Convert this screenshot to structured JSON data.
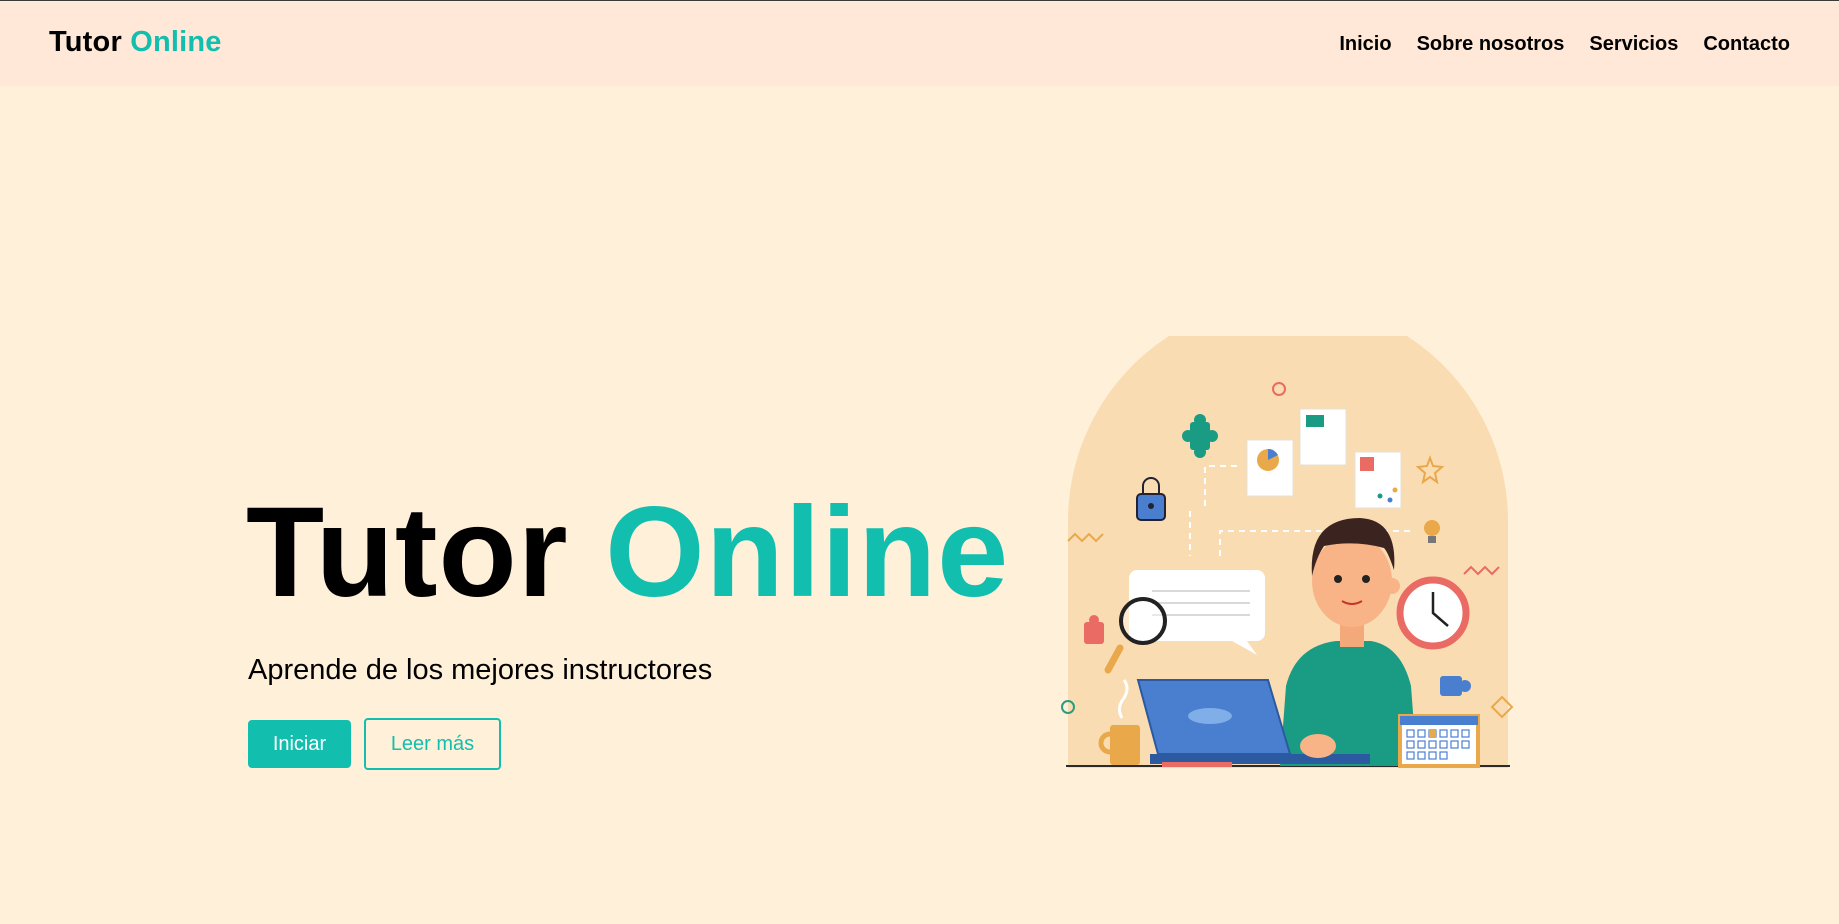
{
  "brand": {
    "part1": "Tutor",
    "part2": "Online"
  },
  "nav": {
    "items": [
      "Inicio",
      "Sobre nosotros",
      "Servicios",
      "Contacto"
    ]
  },
  "hero": {
    "title_part1": "Tutor",
    "title_part2": "Online",
    "subtitle": "Aprende de los mejores instructores",
    "primary_button": "Iniciar",
    "secondary_button": "Leer más"
  },
  "colors": {
    "accent": "#12bfae",
    "background": "#fff0da",
    "navbar": "#ffe8d8"
  },
  "illustration": {
    "icon": "student-laptop-illustration"
  }
}
